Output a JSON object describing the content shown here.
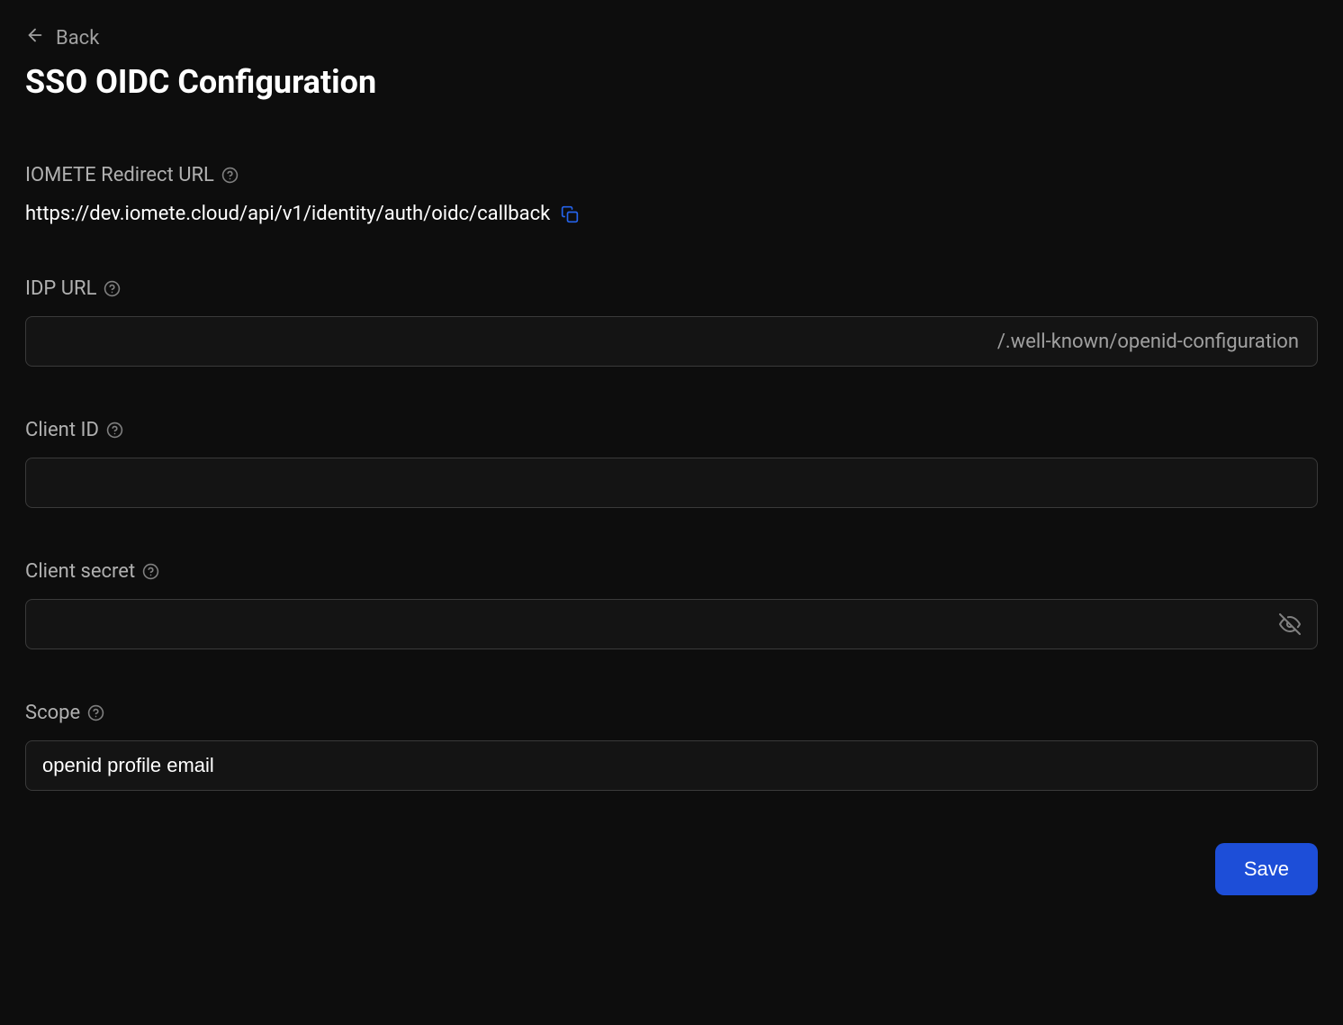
{
  "header": {
    "back_label": "Back",
    "page_title": "SSO OIDC Configuration"
  },
  "fields": {
    "redirect_url": {
      "label": "IOMETE Redirect URL",
      "value": "https://dev.iomete.cloud/api/v1/identity/auth/oidc/callback"
    },
    "idp_url": {
      "label": "IDP URL",
      "value": "",
      "suffix": "/.well-known/openid-configuration"
    },
    "client_id": {
      "label": "Client ID",
      "value": ""
    },
    "client_secret": {
      "label": "Client secret",
      "value": ""
    },
    "scope": {
      "label": "Scope",
      "value": "openid profile email"
    }
  },
  "footer": {
    "save_label": "Save"
  }
}
